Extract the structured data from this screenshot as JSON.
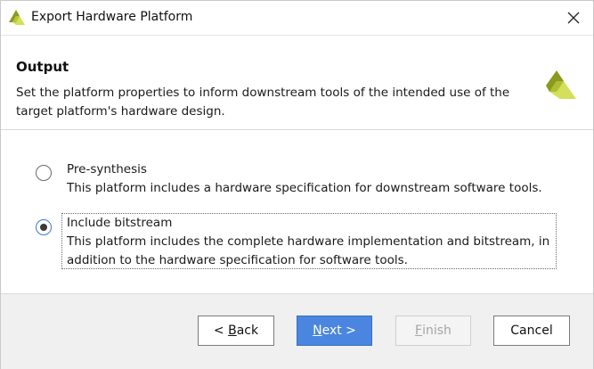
{
  "window": {
    "title": "Export Hardware Platform"
  },
  "header": {
    "title": "Output",
    "description": "Set the platform properties to inform downstream tools of the intended use of the target platform's hardware design."
  },
  "options": [
    {
      "label": "Pre-synthesis",
      "description": "This platform includes a hardware specification for downstream software tools.",
      "selected": false
    },
    {
      "label": "Include bitstream",
      "description": "This platform includes the complete hardware implementation and bitstream, in addition to the hardware specification for software tools.",
      "selected": true
    }
  ],
  "buttons": {
    "back": {
      "prefix": "< ",
      "mnemonic": "B",
      "rest": "ack"
    },
    "next": {
      "mnemonic": "N",
      "rest": "ext >"
    },
    "finish": {
      "mnemonic": "F",
      "rest": "inish"
    },
    "cancel": "Cancel"
  },
  "colors": {
    "logo_dark": "#8a9a1e",
    "logo_light": "#d4df5a",
    "primary_button": "#4a86e0",
    "radio_focus": "#3b79d1"
  },
  "icons": {
    "title_logo": "xilinx-logo-icon",
    "header_logo": "xilinx-logo-icon",
    "close": "close-icon"
  }
}
